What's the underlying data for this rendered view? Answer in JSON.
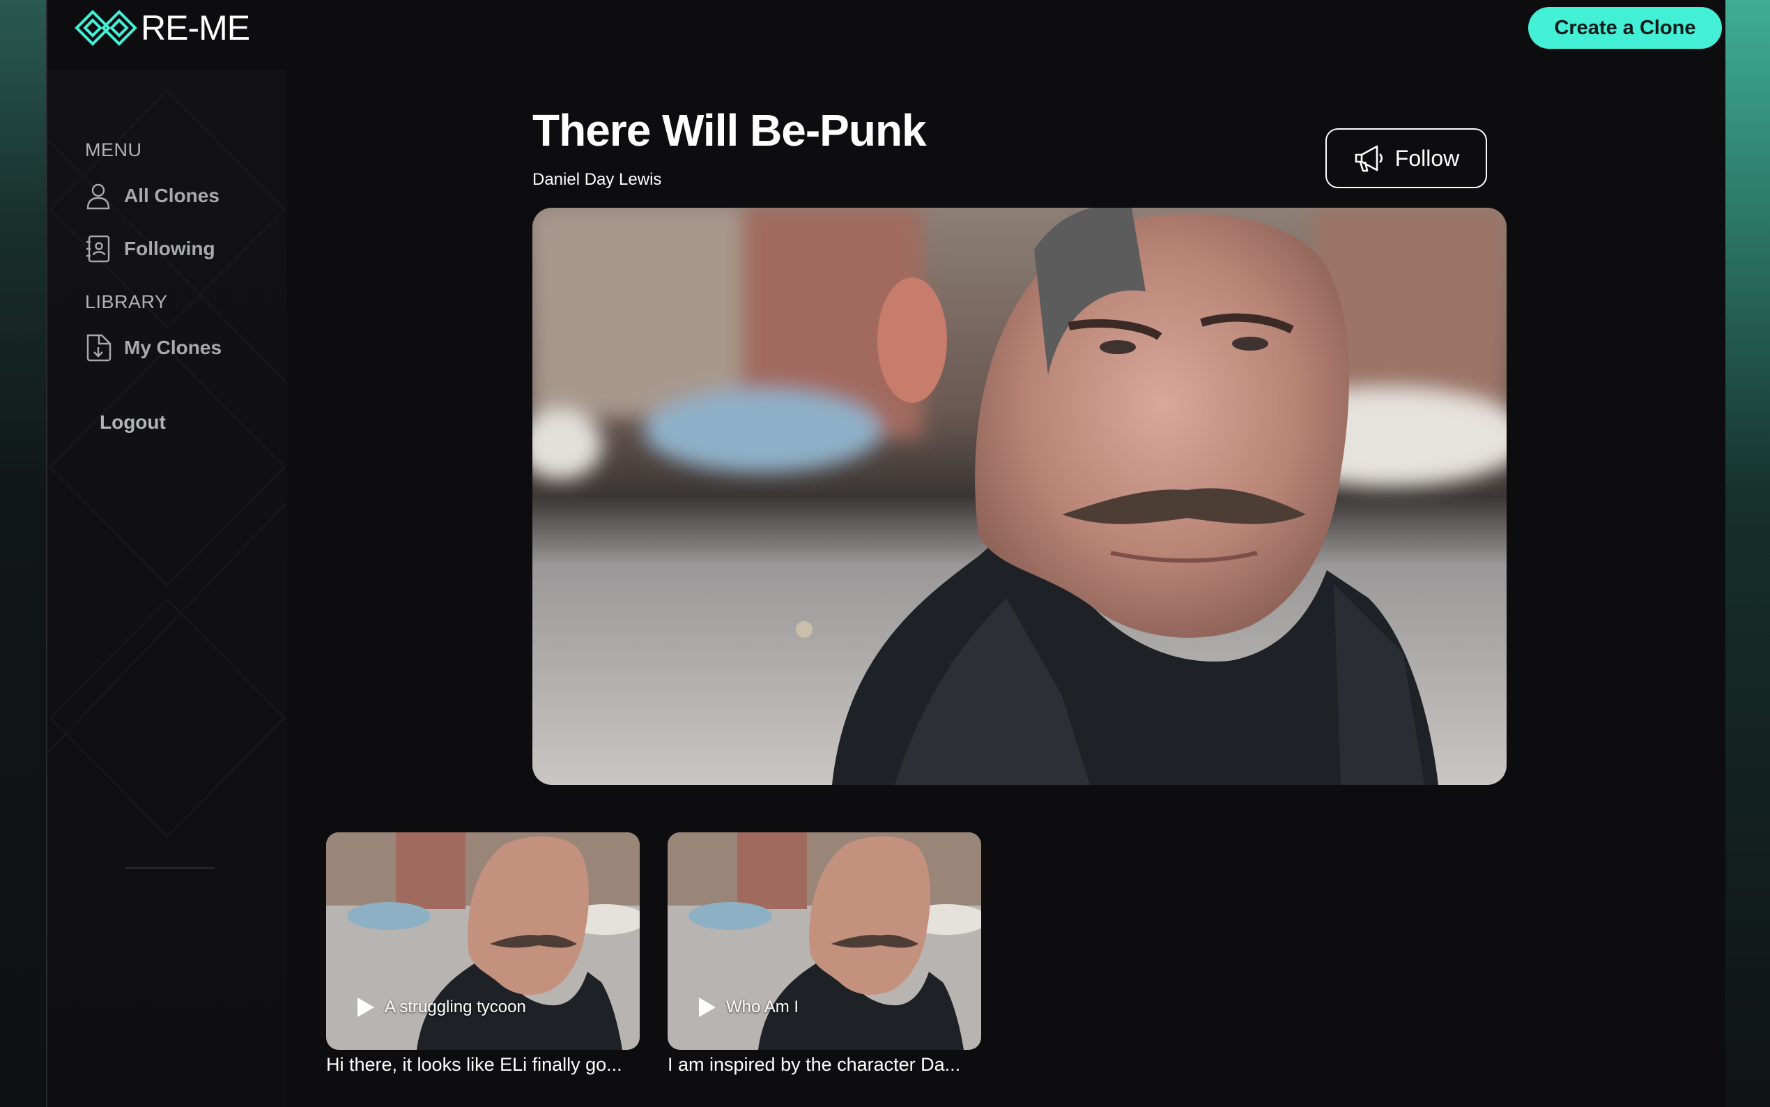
{
  "brand": {
    "name": "RE-ME",
    "accent": "#43f0d6"
  },
  "header": {
    "create_label": "Create a Clone"
  },
  "sidebar": {
    "menu_label": "MENU",
    "library_label": "LIBRARY",
    "items": [
      {
        "label": "All Clones",
        "icon": "user-icon"
      },
      {
        "label": "Following",
        "icon": "contacts-book-icon"
      },
      {
        "label": "My Clones",
        "icon": "document-download-icon"
      }
    ],
    "logout_label": "Logout"
  },
  "clone": {
    "title": "There Will Be-Punk",
    "creator": "Daniel Day Lewis",
    "follow_label": "Follow",
    "hero_image": "portrait-photo-man-leather-jacket"
  },
  "videos": [
    {
      "label": "A struggling tycoon",
      "caption": "Hi there, it looks like ELi finally go..."
    },
    {
      "label": "Who Am I",
      "caption": "I am inspired by the character Da..."
    }
  ]
}
